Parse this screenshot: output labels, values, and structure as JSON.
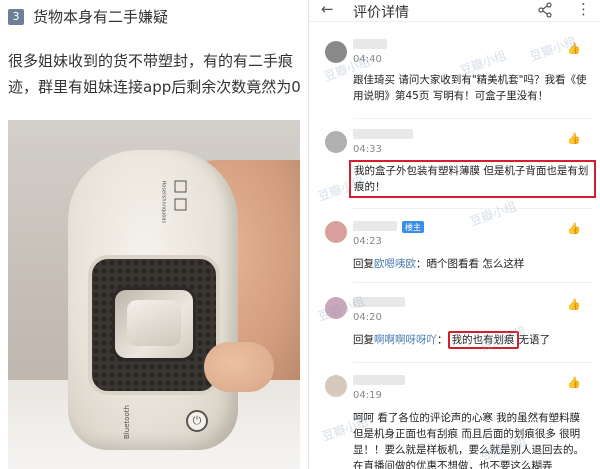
{
  "left": {
    "step_number": "3",
    "heading": "货物本身有二手嫌疑",
    "paragraph": "很多姐妹收到的货不带塑封，有的有二手痕迹，群里有姐妹连接app后剩余次数竟然为0",
    "photo": {
      "device_brand": "Hoseilshnnqubas",
      "bluetooth_label": "Bluetooth",
      "power_icon": "power-icon"
    }
  },
  "right": {
    "topbar": {
      "back_icon": "back-arrow-icon",
      "title": "评价详情",
      "share_icon": "share-icon",
      "more_icon": "more-vertical-icon"
    },
    "comments": [
      {
        "time": "04:40",
        "text": "跟佳琦买 请问大家收到有\"精美机套\"吗？我看《使用说明》第45页 写明有！可盒子里没有！",
        "avatar_color": "#8a8a8a"
      },
      {
        "time": "04:33",
        "text_highlighted": "我的盒子外包装有塑料薄膜 但是机子背面也是有划痕的！",
        "avatar_color": "#b0b0b0"
      },
      {
        "time": "04:23",
        "owner_badge": "楼主",
        "reply_prefix": "回复",
        "reply_name": "欧嗯咦欧",
        "reply_text": "：晒个图看看 怎么这样",
        "avatar_color": "#d9a0a0"
      },
      {
        "time": "04:20",
        "reply_prefix": "回复",
        "reply_name": "啊啊啊呀呀吖",
        "reply_sep": "：",
        "highlighted": "我的也有划痕",
        "text_after": "无语了",
        "avatar_color": "#c9a6b8"
      },
      {
        "time": "04:19",
        "text": "呵呵 看了各位的评论声的心寒 我的虽然有塑料膜 但是机身正面也有刮痕 而且后面的划痕很多 很明显！！要么就是样板机，要么就是别人退回去的。在直播间做的优惠不想做，也不要这么糊弄",
        "avatar_color": "#d7c8bd"
      }
    ],
    "watermark": "豆瓣小组",
    "like_icon": "thumb-up-icon"
  }
}
